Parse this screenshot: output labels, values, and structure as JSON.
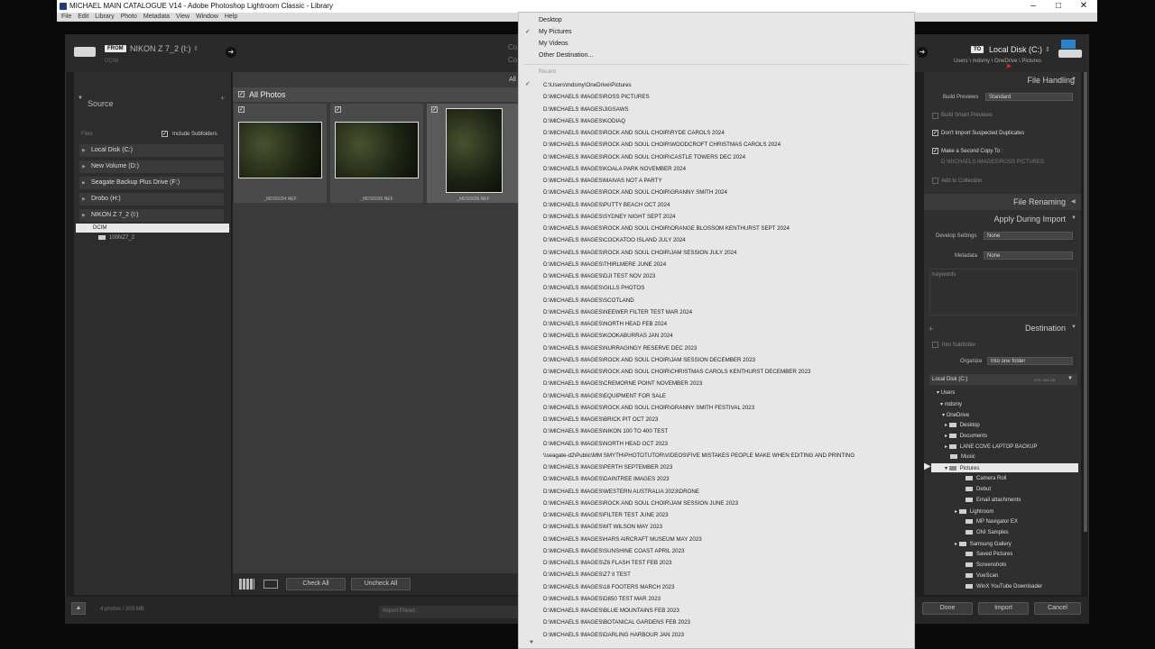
{
  "window": {
    "title": "MICHAEL MAIN CATALOGUE V14 - Adobe Photoshop Lightroom Classic - Library",
    "controls": [
      "–",
      "□",
      "✕"
    ]
  },
  "menubar": [
    "File",
    "Edit",
    "Library",
    "Photo",
    "Metadata",
    "View",
    "Window",
    "Help"
  ],
  "from": {
    "badge": "FROM",
    "source_name": "NIKON Z 7_2 (I:)",
    "subpath": "DCIM"
  },
  "to": {
    "badge": "TO",
    "dest_name": "Local Disk (C:)",
    "path": "Users \\ mdsmy \\ OneDrive \\ Pictures"
  },
  "source_panel": {
    "title": "Source",
    "files_label": "Files",
    "include_subfolders": "Include Subfolders",
    "volumes": [
      "Local Disk (C:)",
      "New Volume (D:)",
      "Seagate Backup Plus Drive (F:)",
      "Drobo (H:)",
      "NIKON Z 7_2 (I:)"
    ],
    "dcim": "DCIM",
    "subfolder": "100NZ7_2"
  },
  "grid": {
    "header": "All Photos",
    "top_right": "All",
    "thumbs": [
      {
        "caption": "_MDS5034.NEF"
      },
      {
        "caption": "_MDS5035.NEF"
      },
      {
        "caption": "_MDS5036.NEF"
      }
    ]
  },
  "toolbar": {
    "check_all": "Check All",
    "uncheck_all": "Uncheck All"
  },
  "footer": {
    "count": "4 photos / 203 MB",
    "import_preset": "Import Preset :"
  },
  "right_panel": {
    "file_handling": "File Handling",
    "build_previews_label": "Build Previews",
    "build_previews_value": "Standard",
    "build_smart": "Build Smart Previews",
    "dont_import_dupes": "Don't Import Suspected Duplicates",
    "second_copy": "Make a Second Copy To :",
    "second_copy_path": "D:\\MICHAELS IMAGES\\ROSS PICTURES",
    "add_to_collection": "Add to Collection",
    "file_renaming": "File Renaming",
    "apply_during_import": "Apply During Import",
    "develop_label": "Develop Settings",
    "develop_value": "None",
    "metadata_label": "Metadata",
    "metadata_value": "None",
    "keywords_label": "Keywords",
    "destination": "Destination",
    "into_subfolder": "Into Subfolder",
    "organize_label": "Organize",
    "organize_value": "Into one folder",
    "disk_label": "Local Disk (C:)",
    "disk_space": "878 / 465 GB",
    "tree": [
      "Users",
      "mdsmy",
      "OneDrive",
      "Desktop",
      "Documents",
      "LANE COVE LAPTOP BACKUP",
      "Music",
      "Pictures",
      "Camera Roll",
      "Debut",
      "Email attachments",
      "Lightroom",
      "MP Navigator EX",
      "ONI Samples",
      "Samsung Gallery",
      "Saved Pictures",
      "Screenshots",
      "VueScan",
      "WinX YouTube Downloader"
    ]
  },
  "actions": {
    "done": "Done",
    "import": "Import",
    "cancel": "Cancel"
  },
  "dropdown": {
    "top_items": [
      "Desktop",
      "My Pictures",
      "My Videos",
      "Other Destination..."
    ],
    "recent_header": "Recent",
    "recent": [
      "C:\\Users\\mdsmy\\OneDrive\\Pictures",
      "D:\\MICHAELS IMAGES\\ROSS PICTURES",
      "D:\\MICHAELS IMAGES\\JIGSAWS",
      "D:\\MICHAELS IMAGES\\KODIAQ",
      "D:\\MICHAELS IMAGES\\ROCK AND SOUL CHOIR\\RYDE CAROLS 2024",
      "D:\\MICHAELS IMAGES\\ROCK AND SOUL CHOIR\\WOODCROFT CHRISTMAS CAROLS 2024",
      "D:\\MICHAELS IMAGES\\ROCK AND SOUL CHOIR\\CASTLE TOWERS DEC 2024",
      "D:\\MICHAELS IMAGES\\KOALA PARK NOVEMBER 2024",
      "D:\\MICHAELS IMAGES\\MAIVAS NOT A PARTY",
      "D:\\MICHAELS IMAGES\\ROCK AND SOUL CHOIR\\GRANNY SMITH 2024",
      "D:\\MICHAELS IMAGES\\PUTTY BEACH OCT 2024",
      "D:\\MICHAELS IMAGES\\SYDNEY NIGHT SEPT 2024",
      "D:\\MICHAELS IMAGES\\ROCK AND SOUL CHOIR\\ORANGE BLOSSOM KENTHURST SEPT 2024",
      "D:\\MICHAELS IMAGES\\COCKATOO ISLAND JULY 2024",
      "D:\\MICHAELS IMAGES\\ROCK AND SOUL CHOIR\\JAM SESSION JULY 2024",
      "D:\\MICHAELS IMAGES\\THIRLMERE JUNE 2024",
      "D:\\MICHAELS IMAGES\\DJI TEST NOV 2023",
      "D:\\MICHAELS IMAGES\\GILLS PHOTOS",
      "D:\\MICHAELS IMAGES\\SCOTLAND",
      "D:\\MICHAELS IMAGES\\NEEWER FILTER TEST MAR 2024",
      "D:\\MICHAELS IMAGES\\NORTH HEAD FEB 2024",
      "D:\\MICHAELS IMAGES\\KOOKABURRAS JAN 2024",
      "D:\\MICHAELS IMAGES\\NURRAGINGY RESERVE DEC 2023",
      "D:\\MICHAELS IMAGES\\ROCK AND SOUL CHOIR\\JAM SESSION DECEMBER 2023",
      "D:\\MICHAELS IMAGES\\ROCK AND SOUL CHOIR\\CHRISTMAS CAROLS KENTHURST DECEMBER 2023",
      "D:\\MICHAELS IMAGES\\CREMORNE POINT NOVEMBER 2023",
      "D:\\MICHAELS IMAGES\\EQUIPMENT FOR SALE",
      "D:\\MICHAELS IMAGES\\ROCK AND SOUL CHOIR\\GRANNY SMITH FESTIVAL 2023",
      "D:\\MICHAELS IMAGES\\BRICK PIT OCT 2023",
      "D:\\MICHAELS IMAGES\\NIKON 100 TO 400 TEST",
      "D:\\MICHAELS IMAGES\\NORTH HEAD OCT 2023",
      "\\\\seagate-d2\\Public\\MM SMYTH\\PHOTOTUTOR\\VIDEOS\\FIVE MISTAKES PEOPLE MAKE WHEN EDITING AND PRINTING",
      "D:\\MICHAELS IMAGES\\PERTH SEPTEMBER 2023",
      "D:\\MICHAELS IMAGES\\DAINTREE IMAGES 2023",
      "D:\\MICHAELS IMAGES\\WESTERN AUSTRALIA 2023\\DRONE",
      "D:\\MICHAELS IMAGES\\ROCK AND SOUL CHOIR\\JAM SESSION JUNE 2023",
      "D:\\MICHAELS IMAGES\\FILTER TEST JUNE 2023",
      "D:\\MICHAELS IMAGES\\MT WILSON MAY 2023",
      "D:\\MICHAELS IMAGES\\HARS AIRCRAFT MUSEUM MAY 2023",
      "D:\\MICHAELS IMAGES\\SUNSHINE COAST APRIL 2023",
      "D:\\MICHAELS IMAGES\\Z6 FLASH TEST FEB 2023",
      "D:\\MICHAELS IMAGES\\Z7 II TEST",
      "D:\\MICHAELS IMAGES\\18 FOOTERS MARCH 2023",
      "D:\\MICHAELS IMAGES\\D850 TEST MAR 2023",
      "D:\\MICHAELS IMAGES\\BLUE MOUNTAINS FEB 2023",
      "D:\\MICHAELS IMAGES\\BOTANICAL GARDENS FEB 2023",
      "D:\\MICHAELS IMAGES\\DARLING HARBOUR JAN 2023"
    ]
  },
  "colors": {
    "menu_bg": "#e7e7e7",
    "dialog_bg": "#1e1e1e",
    "panel_bg": "#2f2f2f",
    "selected_row": "#e8e8e8"
  }
}
